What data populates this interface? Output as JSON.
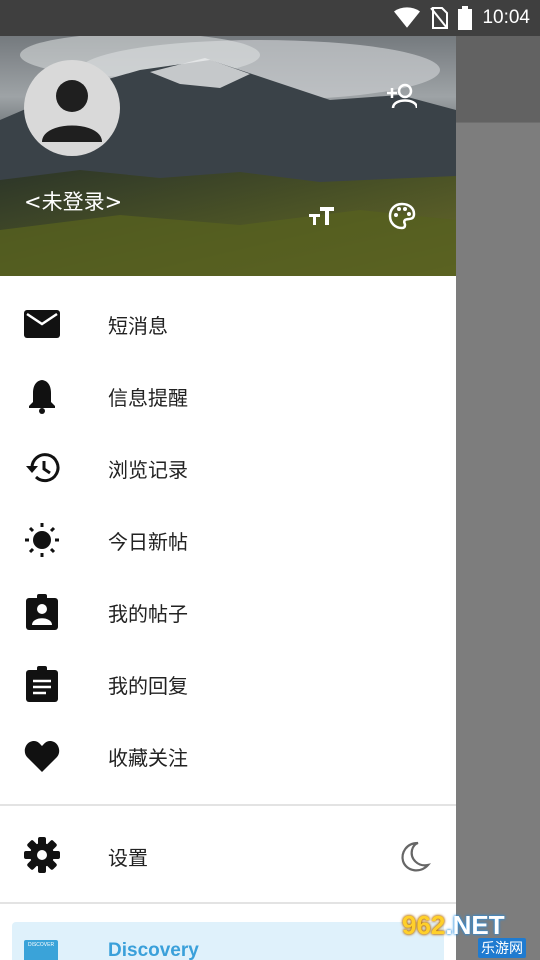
{
  "status_bar": {
    "time": "10:04",
    "icons": [
      "wifi-icon",
      "no-sim-icon",
      "battery-icon"
    ]
  },
  "drawer": {
    "header": {
      "username": "<未登录>",
      "icons": [
        "add-account-icon",
        "text-size-icon",
        "palette-icon"
      ]
    },
    "menu": [
      {
        "label": "短消息",
        "icon": "mail-icon"
      },
      {
        "label": "信息提醒",
        "icon": "bell-icon"
      },
      {
        "label": "浏览记录",
        "icon": "history-icon"
      },
      {
        "label": "今日新帖",
        "icon": "sun-icon"
      },
      {
        "label": "我的帖子",
        "icon": "assignment-ind-icon"
      },
      {
        "label": "我的回复",
        "icon": "clipboard-icon"
      },
      {
        "label": "收藏关注",
        "icon": "heart-icon"
      }
    ],
    "settings": {
      "label": "设置",
      "icon": "gear-icon",
      "night_icon": "moon-icon"
    },
    "discovery": {
      "label": "Discovery",
      "card_text": "DISCOVER"
    }
  },
  "watermark": {
    "main_prefix": "",
    "main_num": "962",
    "main_suffix": ".NET",
    "sub": "乐游网"
  },
  "colors": {
    "accent": "#3aa0da",
    "discovery_bg": "#dff1fb",
    "scrim": "#7d7d7d"
  }
}
